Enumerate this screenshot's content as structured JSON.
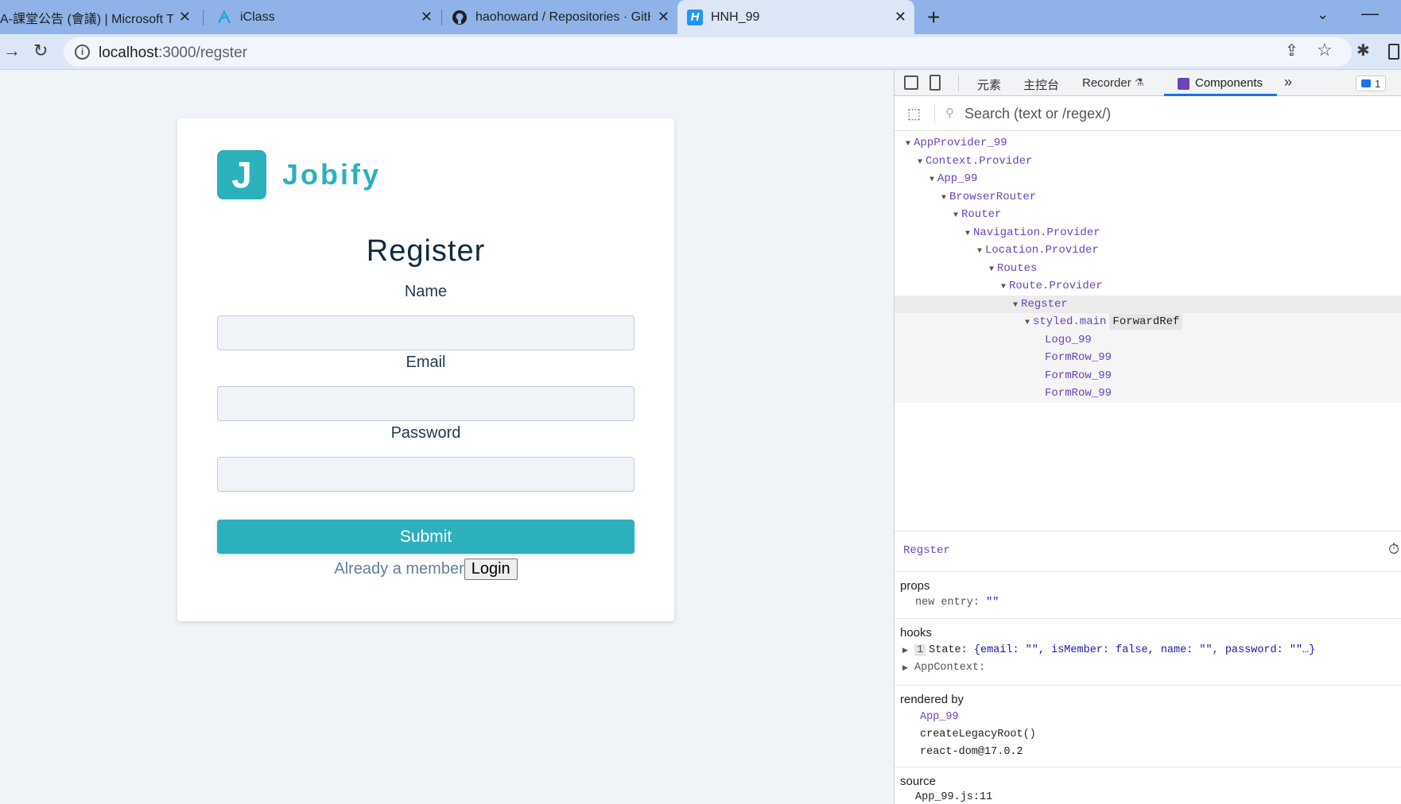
{
  "browser": {
    "tabs": [
      {
        "title": "A-課堂公告 (會議) | Microsoft Te",
        "active": false
      },
      {
        "title": "iClass",
        "active": false
      },
      {
        "title": "haohoward / Repositories · GitH",
        "active": false
      },
      {
        "title": "HNH_99",
        "active": true
      }
    ],
    "new_tab": "+",
    "url_host": "localhost",
    "url_path": ":3000/regster"
  },
  "page": {
    "logo_letter": "J",
    "logo_text": "Jobify",
    "title": "Register",
    "fields": {
      "name_label": "Name",
      "email_label": "Email",
      "password_label": "Password"
    },
    "submit_label": "Submit",
    "member_text": "Already a member",
    "login_label": "Login"
  },
  "devtools": {
    "tabs": [
      "元素",
      "主控台",
      "Recorder",
      "Components"
    ],
    "more": "»",
    "issues_count": "1",
    "search_placeholder": "Search (text or /regex/)",
    "tree": [
      {
        "label": "AppProvider_99",
        "depth": 0,
        "expanded": true
      },
      {
        "label": "Context.Provider",
        "depth": 1,
        "expanded": true
      },
      {
        "label": "App_99",
        "depth": 2,
        "expanded": true
      },
      {
        "label": "BrowserRouter",
        "depth": 3,
        "expanded": true
      },
      {
        "label": "Router",
        "depth": 4,
        "expanded": true
      },
      {
        "label": "Navigation.Provider",
        "depth": 5,
        "expanded": true
      },
      {
        "label": "Location.Provider",
        "depth": 6,
        "expanded": true
      },
      {
        "label": "Routes",
        "depth": 7,
        "expanded": true
      },
      {
        "label": "Route.Provider",
        "depth": 8,
        "expanded": true
      },
      {
        "label": "Regster",
        "depth": 9,
        "expanded": true,
        "selected": true
      },
      {
        "label": "styled.main",
        "depth": 10,
        "expanded": true,
        "badge": "ForwardRef",
        "dim": true
      },
      {
        "label": "Logo_99",
        "depth": 11,
        "expanded": false,
        "dim": true
      },
      {
        "label": "FormRow_99",
        "depth": 11,
        "expanded": false,
        "dim": true
      },
      {
        "label": "FormRow_99",
        "depth": 11,
        "expanded": false,
        "dim": true
      },
      {
        "label": "FormRow_99",
        "depth": 11,
        "expanded": false,
        "dim": true
      }
    ],
    "inspector": {
      "component": "Regster",
      "props_title": "props",
      "props_key": "new entry",
      "props_value": "\"\"",
      "hooks_title": "hooks",
      "hook_index": "1",
      "hook_state_key": "State",
      "hook_state_value": "{email: \"\", isMember: false, name: \"\", password: \"\"…}",
      "hook_context": "AppContext",
      "rendered_by_title": "rendered by",
      "rendered_by": [
        "App_99",
        "createLegacyRoot()",
        "react-dom@17.0.2"
      ],
      "source_title": "source",
      "source_value": "App_99.js:11"
    }
  }
}
